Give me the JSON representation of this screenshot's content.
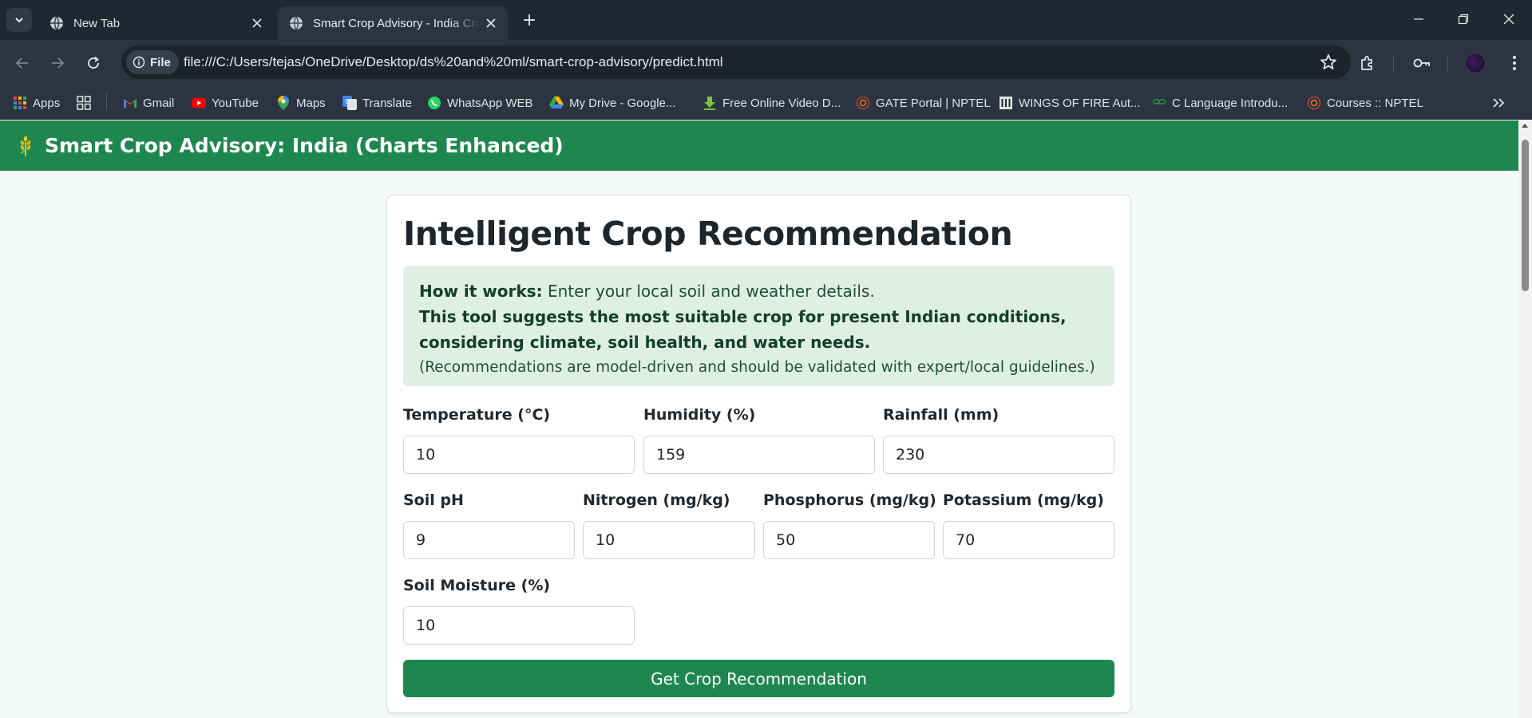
{
  "browser": {
    "tabs": [
      {
        "title": "New Tab"
      },
      {
        "title": "Smart Crop Advisory - India Crop Recommendation"
      }
    ],
    "site_chip": "File",
    "url": "file:///C:/Users/tejas/OneDrive/Desktop/ds%20and%20ml/smart-crop-advisory/predict.html",
    "bookmarks": [
      {
        "label": "Apps"
      },
      {
        "label": ""
      },
      {
        "label": "Gmail"
      },
      {
        "label": "YouTube"
      },
      {
        "label": "Maps"
      },
      {
        "label": "Translate"
      },
      {
        "label": "WhatsApp WEB"
      },
      {
        "label": "My Drive - Google..."
      },
      {
        "label": "Free Online Video D..."
      },
      {
        "label": "GATE Portal | NPTEL"
      },
      {
        "label": "WINGS OF FIRE Aut..."
      },
      {
        "label": "C Language Introdu..."
      },
      {
        "label": "Courses :: NPTEL"
      }
    ]
  },
  "header": {
    "title": "Smart Crop Advisory: India (Charts Enhanced)"
  },
  "card": {
    "title": "Intelligent Crop Recommendation",
    "info": {
      "how_label": "How it works:",
      "how_text": " Enter your local soil and weather details.",
      "bold_line": "This tool suggests the most suitable crop for present Indian conditions, considering climate, soil health, and water needs.",
      "note": "(Recommendations are model-driven and should be validated with expert/local guidelines.)"
    },
    "fields": {
      "temperature": {
        "label": "Temperature (°C)",
        "value": "10"
      },
      "humidity": {
        "label": "Humidity (%)",
        "value": "159"
      },
      "rainfall": {
        "label": "Rainfall (mm)",
        "value": "230"
      },
      "ph": {
        "label": "Soil pH",
        "value": "9"
      },
      "nitrogen": {
        "label": "Nitrogen (mg/kg)",
        "value": "10"
      },
      "phosphorus": {
        "label": "Phosphorus (mg/kg)",
        "value": "50"
      },
      "potassium": {
        "label": "Potassium (mg/kg)",
        "value": "70"
      },
      "moisture": {
        "label": "Soil Moisture (%)",
        "value": "10"
      }
    },
    "submit_label": "Get Crop Recommendation"
  },
  "colors": {
    "brand_green": "#1e8750",
    "info_bg": "#e0efe5",
    "chrome_dark": "#1f2732",
    "chrome_toolbar": "#2b3440"
  },
  "icons": [
    "tab-search-icon",
    "globe-icon",
    "close-icon",
    "plus-icon",
    "minimize-icon",
    "restore-icon",
    "back-icon",
    "forward-icon",
    "reload-icon",
    "info-icon",
    "star-icon",
    "extensions-icon",
    "password-key-icon",
    "apps-grid-icon",
    "gmail-icon",
    "youtube-icon",
    "maps-icon",
    "translate-icon",
    "whatsapp-icon",
    "drive-icon",
    "download-icon",
    "nptel-icon",
    "museum-icon",
    "gfg-icon",
    "chevron-double-right-icon",
    "wheat-icon"
  ]
}
